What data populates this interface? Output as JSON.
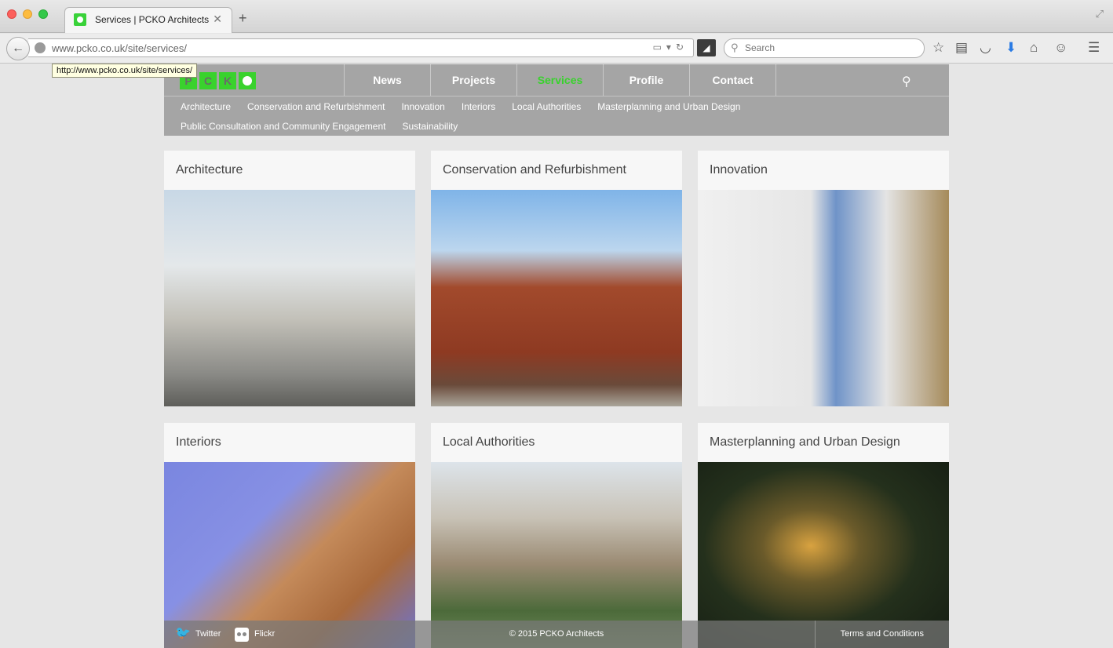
{
  "browser": {
    "tab_title": "Services | PCKO Architects",
    "tab_close": "✕",
    "new_tab": "+",
    "url": "www.pcko.co.uk/site/services/",
    "tooltip": "http://www.pcko.co.uk/site/services/",
    "search_placeholder": "Search"
  },
  "header": {
    "logo_letters": [
      "P",
      "C",
      "K",
      "O"
    ],
    "nav": [
      {
        "label": "News",
        "active": false
      },
      {
        "label": "Projects",
        "active": false
      },
      {
        "label": "Services",
        "active": true
      },
      {
        "label": "Profile",
        "active": false
      },
      {
        "label": "Contact",
        "active": false
      }
    ],
    "subnav": [
      "Architecture",
      "Conservation and Refurbishment",
      "Innovation",
      "Interiors",
      "Local Authorities",
      "Masterplanning and Urban Design",
      "Public Consultation and Community Engagement",
      "Sustainability"
    ]
  },
  "cards": [
    {
      "title": "Architecture"
    },
    {
      "title": "Conservation and Refurbishment"
    },
    {
      "title": "Innovation"
    },
    {
      "title": "Interiors"
    },
    {
      "title": "Local Authorities"
    },
    {
      "title": "Masterplanning and Urban Design"
    }
  ],
  "footer": {
    "twitter": "Twitter",
    "flickr": "Flickr",
    "copyright": "© 2015 PCKO Architects",
    "terms": "Terms and Conditions"
  },
  "colors": {
    "brand_green": "#39d22d",
    "header_gray": "#a5a5a5"
  }
}
